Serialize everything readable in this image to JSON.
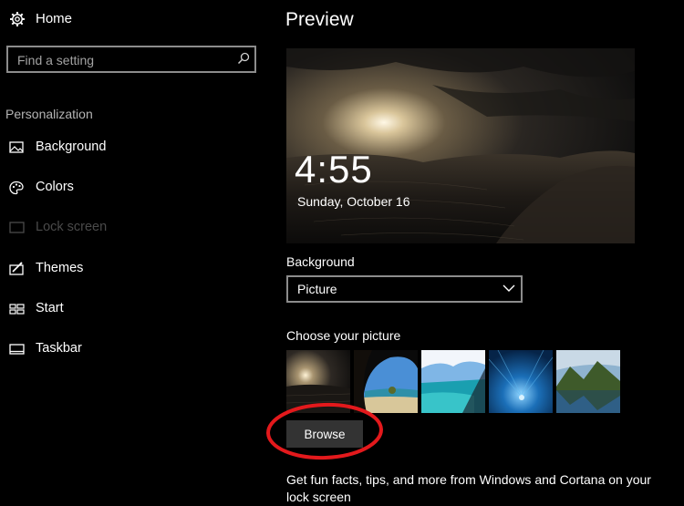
{
  "sidebar": {
    "home_label": "Home",
    "search_placeholder": "Find a setting",
    "section_title": "Personalization",
    "items": [
      {
        "label": "Background",
        "icon": "image-icon",
        "disabled": false
      },
      {
        "label": "Colors",
        "icon": "palette-icon",
        "disabled": false
      },
      {
        "label": "Lock screen",
        "icon": "lock-screen-icon",
        "disabled": true
      },
      {
        "label": "Themes",
        "icon": "themes-icon",
        "disabled": false
      },
      {
        "label": "Start",
        "icon": "start-icon",
        "disabled": false
      },
      {
        "label": "Taskbar",
        "icon": "taskbar-icon",
        "disabled": false
      }
    ]
  },
  "main": {
    "preview_title": "Preview",
    "preview_time": "4:55",
    "preview_date": "Sunday, October 16",
    "background_label": "Background",
    "background_value": "Picture",
    "choose_label": "Choose your picture",
    "thumbnails": [
      "desert-sunset",
      "beach-cave",
      "turquoise-coast",
      "ice-cave",
      "mountain-lake"
    ],
    "browse_label": "Browse",
    "fun_facts": "Get fun facts, tips, and more from Windows and Cortana on your lock screen"
  },
  "colors": {
    "background": "#000000",
    "text": "#ffffff",
    "muted_text": "#b5b5b5",
    "disabled_text": "#4a4a4a",
    "border": "#8c8c8c",
    "button": "#333333",
    "annotation": "#e3191c"
  }
}
